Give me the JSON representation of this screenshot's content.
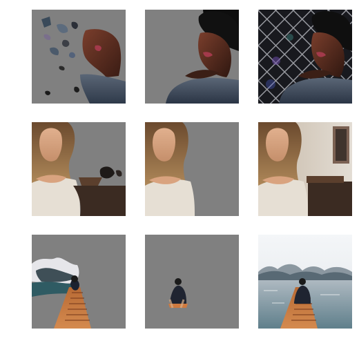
{
  "figure": {
    "rows": [
      {
        "subject": "woman-afro",
        "panels": [
          "masked-partial",
          "masked-subject",
          "original"
        ]
      },
      {
        "subject": "woman-blonde",
        "panels": [
          "masked-partial",
          "masked-subject",
          "original"
        ]
      },
      {
        "subject": "man-on-pier",
        "panels": [
          "masked-partial",
          "masked-subject",
          "original"
        ]
      }
    ],
    "colors": {
      "mask_gray": "#808080",
      "background": "#ffffff"
    }
  }
}
